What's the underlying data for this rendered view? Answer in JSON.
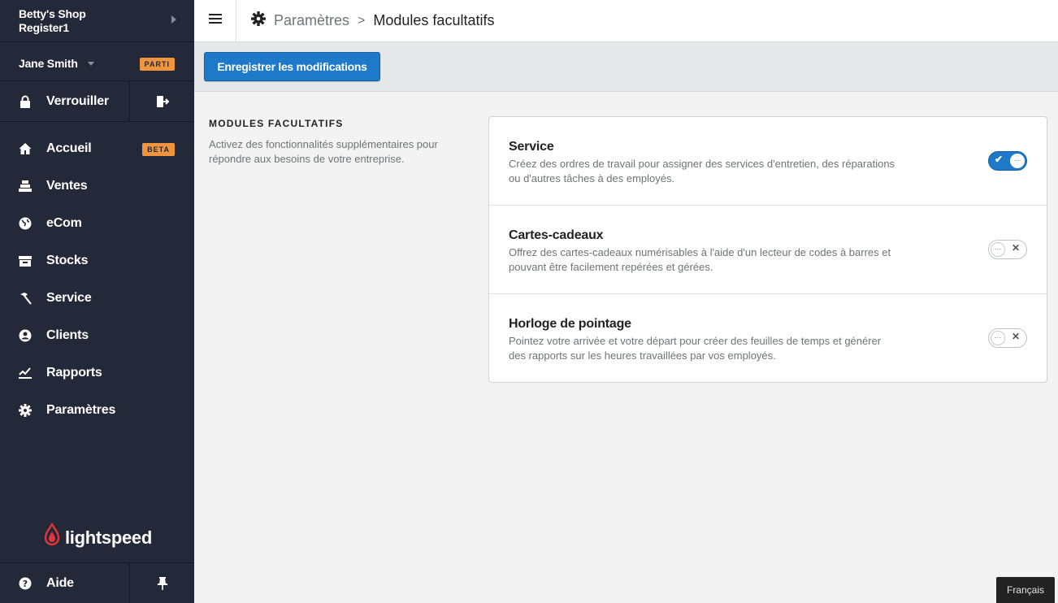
{
  "sidebar": {
    "shop_name": "Betty's Shop",
    "register_name": "Register1",
    "user_name": "Jane Smith",
    "user_badge": "PARTI",
    "lock_label": "Verrouiller",
    "nav": [
      {
        "label": "Accueil",
        "icon": "home-icon",
        "badge": "BETA"
      },
      {
        "label": "Ventes",
        "icon": "register-icon"
      },
      {
        "label": "eCom",
        "icon": "globe-icon"
      },
      {
        "label": "Stocks",
        "icon": "inventory-icon"
      },
      {
        "label": "Service",
        "icon": "hammer-icon"
      },
      {
        "label": "Clients",
        "icon": "customer-icon"
      },
      {
        "label": "Rapports",
        "icon": "chart-icon"
      },
      {
        "label": "Paramètres",
        "icon": "gear-icon"
      }
    ],
    "logo_text": "lightspeed",
    "help_label": "Aide"
  },
  "topbar": {
    "breadcrumb_parent": "Paramètres",
    "breadcrumb_separator": ">",
    "title": "Modules facultatifs"
  },
  "actions": {
    "save_label": "Enregistrer les modifications"
  },
  "section": {
    "title": "MODULES FACULTATIFS",
    "description": "Activez des fonctionnalités supplémentaires pour répondre aux besoins de votre entreprise."
  },
  "modules": [
    {
      "title": "Service",
      "description": "Créez des ordres de travail pour assigner des services d'entretien, des réparations ou d'autres tâches à des employés.",
      "enabled": true
    },
    {
      "title": "Cartes-cadeaux",
      "description": "Offrez des cartes-cadeaux numérisables à l'aide d'un lecteur de codes à barres et pouvant être facilement repérées et gérées.",
      "enabled": false
    },
    {
      "title": "Horloge de pointage",
      "description": "Pointez votre arrivée et votre départ pour créer des feuilles de temps et générer des rapports sur les heures travaillées par vos employés.",
      "enabled": false
    }
  ],
  "language": "Français",
  "colors": {
    "sidebar_bg": "#232938",
    "accent_blue": "#1e7ac8",
    "badge_orange": "#f0953d",
    "logo_red": "#e4343c"
  }
}
